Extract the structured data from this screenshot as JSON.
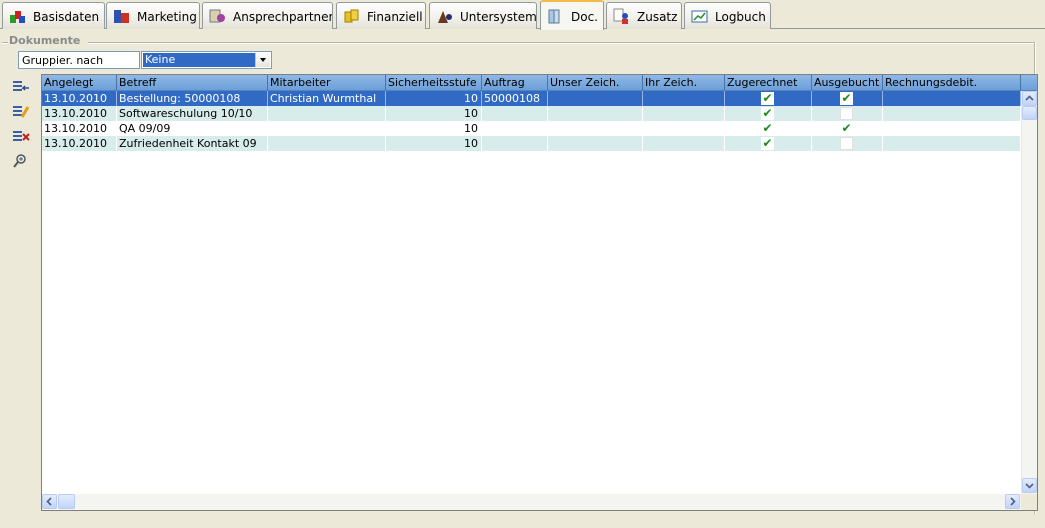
{
  "tabs": [
    {
      "label": "Basisdaten",
      "icon": "colored-blocks-icon",
      "active": false
    },
    {
      "label": "Marketing",
      "icon": "marketing-icon",
      "active": false
    },
    {
      "label": "Ansprechpartner",
      "icon": "contacts-icon",
      "active": false
    },
    {
      "label": "Finanziell",
      "icon": "coins-icon",
      "active": false
    },
    {
      "label": "Untersystem",
      "icon": "users-icon",
      "active": false
    },
    {
      "label": "Doc.",
      "icon": "books-icon",
      "active": true
    },
    {
      "label": "Zusatz",
      "icon": "person-doc-icon",
      "active": false
    },
    {
      "label": "Logbuch",
      "icon": "chart-log-icon",
      "active": false
    }
  ],
  "section": {
    "title": "Dokumente",
    "group_label": "Gruppier. nach",
    "group_value": "Keine"
  },
  "tools": [
    {
      "name": "insert-row-tool-icon"
    },
    {
      "name": "edit-row-tool-icon"
    },
    {
      "name": "delete-row-tool-icon"
    },
    {
      "name": "zoom-tool-icon"
    }
  ],
  "grid": {
    "columns": [
      "Angelegt",
      "Betreff",
      "Mitarbeiter",
      "Sicherheitsstufe",
      "Auftrag",
      "Unser Zeich.",
      "Ihr Zeich.",
      "Zugerechnet",
      "Ausgebucht",
      "Rechnungsdebit."
    ],
    "rows": [
      {
        "angelegt": "13.10.2010",
        "betreff": "Bestellung: 50000108",
        "mitarbeiter": "Christian Wurmthal",
        "stufe": "10",
        "auftrag": "50000108",
        "unser": "",
        "ihr": "",
        "zugerechnet": true,
        "ausgebucht": true,
        "rechnung": "",
        "selected": true
      },
      {
        "angelegt": "13.10.2010",
        "betreff": "Softwareschulung 10/10",
        "mitarbeiter": "",
        "stufe": "10",
        "auftrag": "",
        "unser": "",
        "ihr": "",
        "zugerechnet": true,
        "ausgebucht": false,
        "rechnung": "",
        "selected": false
      },
      {
        "angelegt": "13.10.2010",
        "betreff": "QA 09/09",
        "mitarbeiter": "",
        "stufe": "10",
        "auftrag": "",
        "unser": "",
        "ihr": "",
        "zugerechnet": true,
        "ausgebucht": true,
        "rechnung": "",
        "selected": false
      },
      {
        "angelegt": "13.10.2010",
        "betreff": "Zufriedenheit Kontakt 09",
        "mitarbeiter": "",
        "stufe": "10",
        "auftrag": "",
        "unser": "",
        "ihr": "",
        "zugerechnet": true,
        "ausgebucht": false,
        "rechnung": "",
        "selected": false
      }
    ]
  },
  "colors": {
    "selection": "#316ac5",
    "alt_row": "#d9ecec",
    "header": "#8fb8e6",
    "check": "#1e8a1e"
  }
}
